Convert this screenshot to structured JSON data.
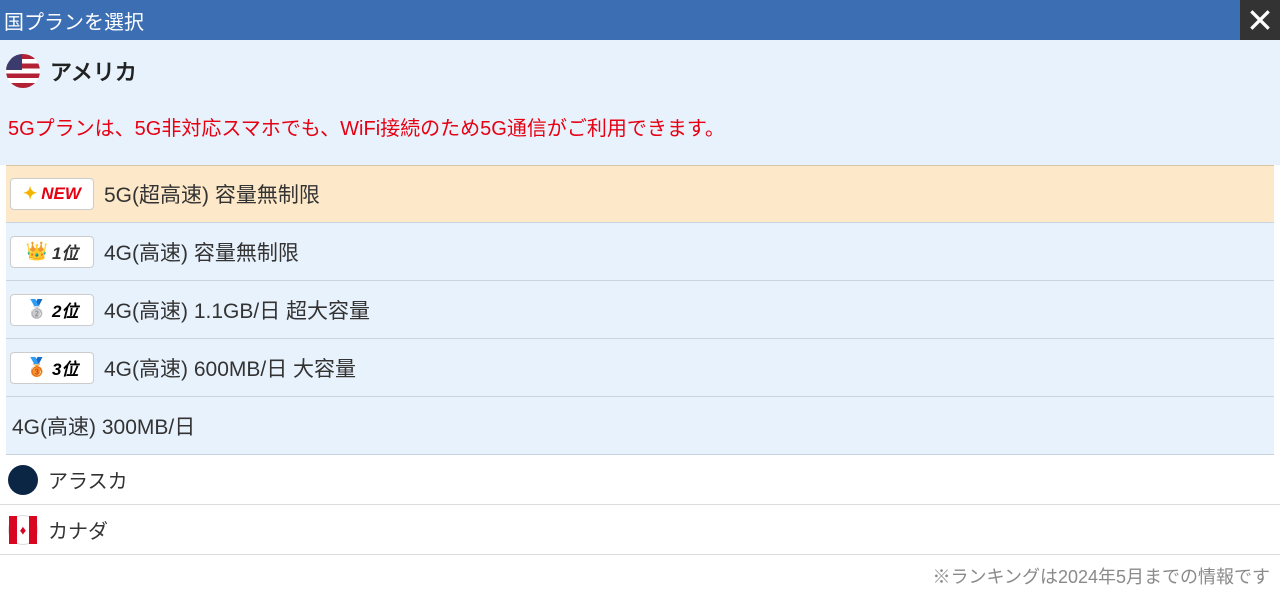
{
  "header": {
    "title": "国プランを選択"
  },
  "country": {
    "name": "アメリカ",
    "notice": "5Gプランは、5G非対応スマホでも、WiFi接続のため5G通信がご利用できます。"
  },
  "badges": {
    "new": "NEW",
    "rank1": "1位",
    "rank2": "2位",
    "rank3": "3位"
  },
  "plans": [
    {
      "badge_type": "new",
      "label": "5G(超高速) 容量無制限",
      "highlighted": true
    },
    {
      "badge_type": "rank1",
      "label": "4G(高速) 容量無制限"
    },
    {
      "badge_type": "rank2",
      "label": "4G(高速) 1.1GB/日 超大容量"
    },
    {
      "badge_type": "rank3",
      "label": "4G(高速) 600MB/日 大容量"
    },
    {
      "badge_type": "none",
      "label": "4G(高速) 300MB/日"
    }
  ],
  "subCountries": [
    {
      "name": "アラスカ",
      "flag": "alaska"
    },
    {
      "name": "カナダ",
      "flag": "canada"
    }
  ],
  "footer": {
    "note": "※ランキングは2024年5月までの情報です"
  }
}
